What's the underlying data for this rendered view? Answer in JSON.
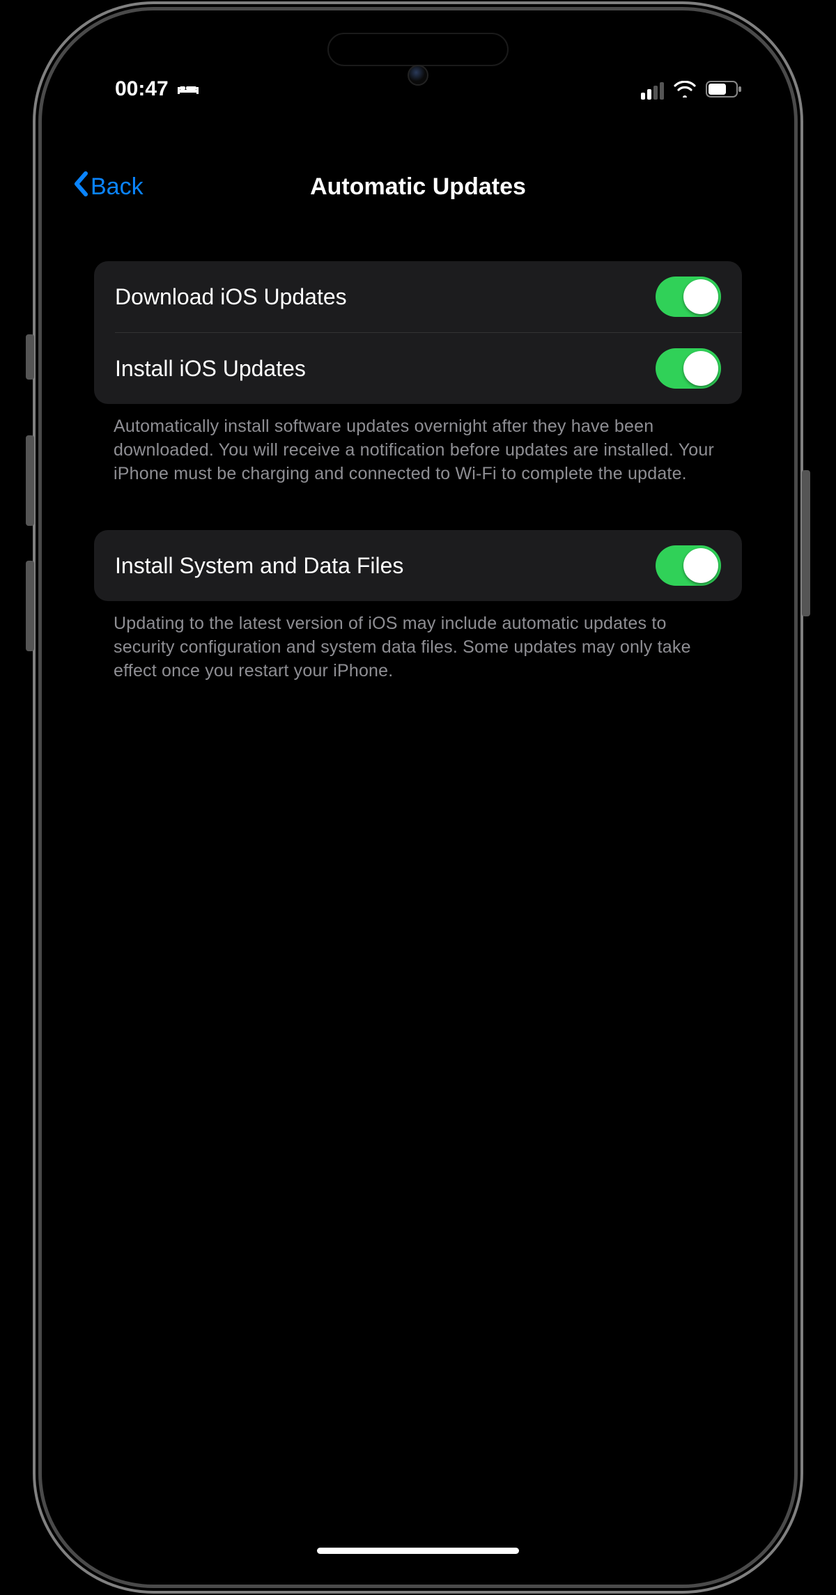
{
  "status": {
    "time": "00:47",
    "bed_icon": "bed-icon",
    "cell_bars_active": 2,
    "wifi_active": true,
    "battery_percent": 60
  },
  "nav": {
    "back_label": "Back",
    "title": "Automatic Updates"
  },
  "group1": {
    "rows": [
      {
        "label": "Download iOS Updates",
        "on": true
      },
      {
        "label": "Install iOS Updates",
        "on": true
      }
    ],
    "footer": "Automatically install software updates overnight after they have been downloaded. You will receive a notification before updates are installed. Your iPhone must be charging and connected to Wi-Fi to complete the update."
  },
  "group2": {
    "rows": [
      {
        "label": "Install System and Data Files",
        "on": true
      }
    ],
    "footer": "Updating to the latest version of iOS may include automatic updates to security configuration and system data files. Some updates may only take effect once you restart your iPhone."
  },
  "colors": {
    "accent": "#0a84ff",
    "toggle_on": "#30d158",
    "cell_bg": "#1c1c1e",
    "footer_text": "#8e8e93"
  }
}
